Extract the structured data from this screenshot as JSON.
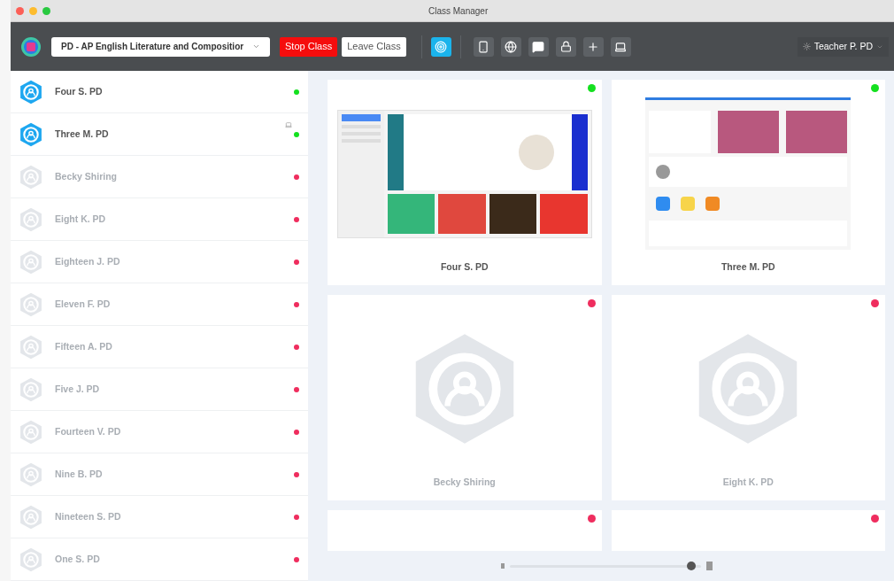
{
  "window": {
    "title": "Class Manager"
  },
  "toolbar": {
    "class_select": {
      "value": "PD - AP English Literature and Compositior"
    },
    "buttons": [
      {
        "label": "Stop Class",
        "kind": "danger"
      },
      {
        "label": "Leave Class",
        "kind": "plain"
      }
    ],
    "teacher": {
      "label": "Teacher P. PD"
    }
  },
  "students": [
    {
      "name": "Four S. PD",
      "online": true,
      "device": false
    },
    {
      "name": "Three M. PD",
      "online": true,
      "device": true
    },
    {
      "name": "Becky Shiring",
      "online": false,
      "device": false
    },
    {
      "name": "Eight K. PD",
      "online": false,
      "device": false
    },
    {
      "name": "Eighteen J. PD",
      "online": false,
      "device": false
    },
    {
      "name": "Eleven F. PD",
      "online": false,
      "device": false
    },
    {
      "name": "Fifteen A. PD",
      "online": false,
      "device": false
    },
    {
      "name": "Five J. PD",
      "online": false,
      "device": false
    },
    {
      "name": "Fourteen V. PD",
      "online": false,
      "device": false
    },
    {
      "name": "Nine B. PD",
      "online": false,
      "device": false
    },
    {
      "name": "Nineteen S. PD",
      "online": false,
      "device": false
    },
    {
      "name": "One S. PD",
      "online": false,
      "device": false
    }
  ],
  "cards": [
    {
      "name": "Four S. PD",
      "online": true,
      "kind": "web"
    },
    {
      "name": "Three M. PD",
      "online": true,
      "kind": "tablet"
    },
    {
      "name": "Becky Shiring",
      "online": false,
      "kind": "avatar"
    },
    {
      "name": "Eight K. PD",
      "online": false,
      "kind": "avatar"
    },
    {
      "online": false,
      "kind": "cut"
    },
    {
      "online": false,
      "kind": "cut"
    }
  ],
  "zoom_slider": {
    "level": 0.95
  }
}
